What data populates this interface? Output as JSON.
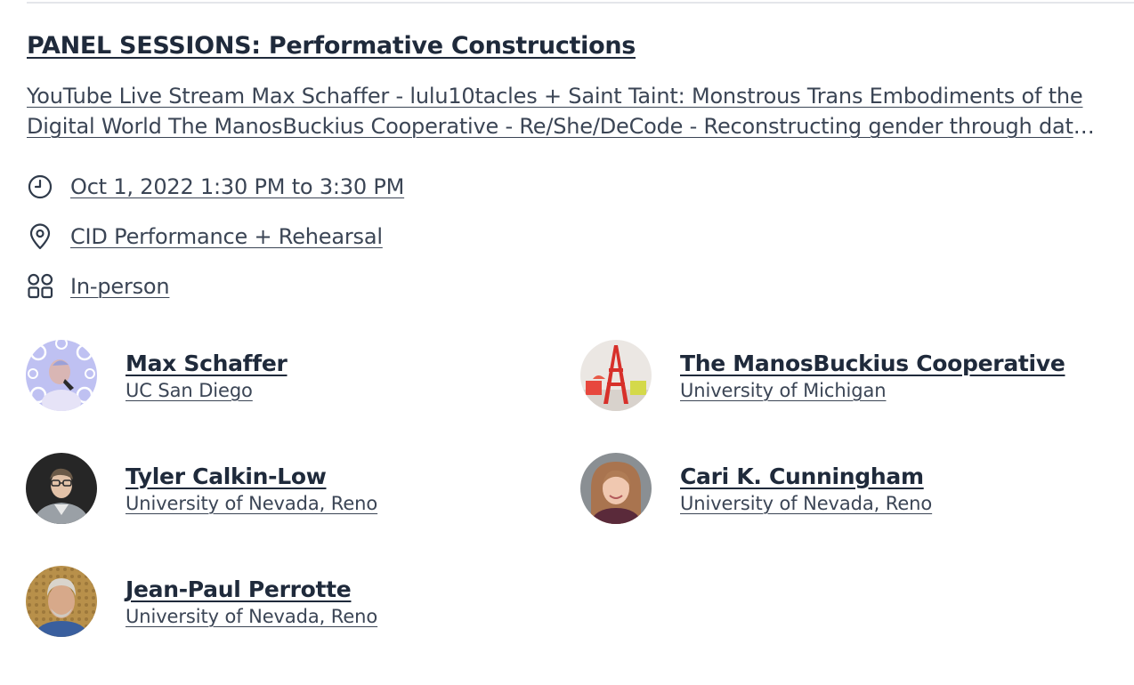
{
  "session": {
    "title": "PANEL SESSIONS: Performative Constructions",
    "description": "YouTube Live Stream Max Schaffer - lulu10tacles + Saint Taint: Monstrous Trans Embodiments of the Digital World The ManosBuckius Cooperative - Re/She/DeCode - Reconstructing gender through data and performance",
    "datetime": "Oct 1, 2022 1:30 PM to 3:30 PM",
    "location": "CID Performance + Rehearsal",
    "format": "In-person",
    "icons": {
      "datetime": "clock-icon",
      "location": "map-pin-icon",
      "format": "grid-icon"
    }
  },
  "speakers": [
    {
      "name": "Max Schaffer",
      "org": "UC San Diego"
    },
    {
      "name": "The ManosBuckius Cooperative",
      "org": "University of Michigan"
    },
    {
      "name": "Tyler Calkin-Low",
      "org": "University of Nevada, Reno"
    },
    {
      "name": "Cari K. Cunningham",
      "org": "University of Nevada, Reno"
    },
    {
      "name": "Jean-Paul Perrotte",
      "org": "University of Nevada, Reno"
    }
  ]
}
